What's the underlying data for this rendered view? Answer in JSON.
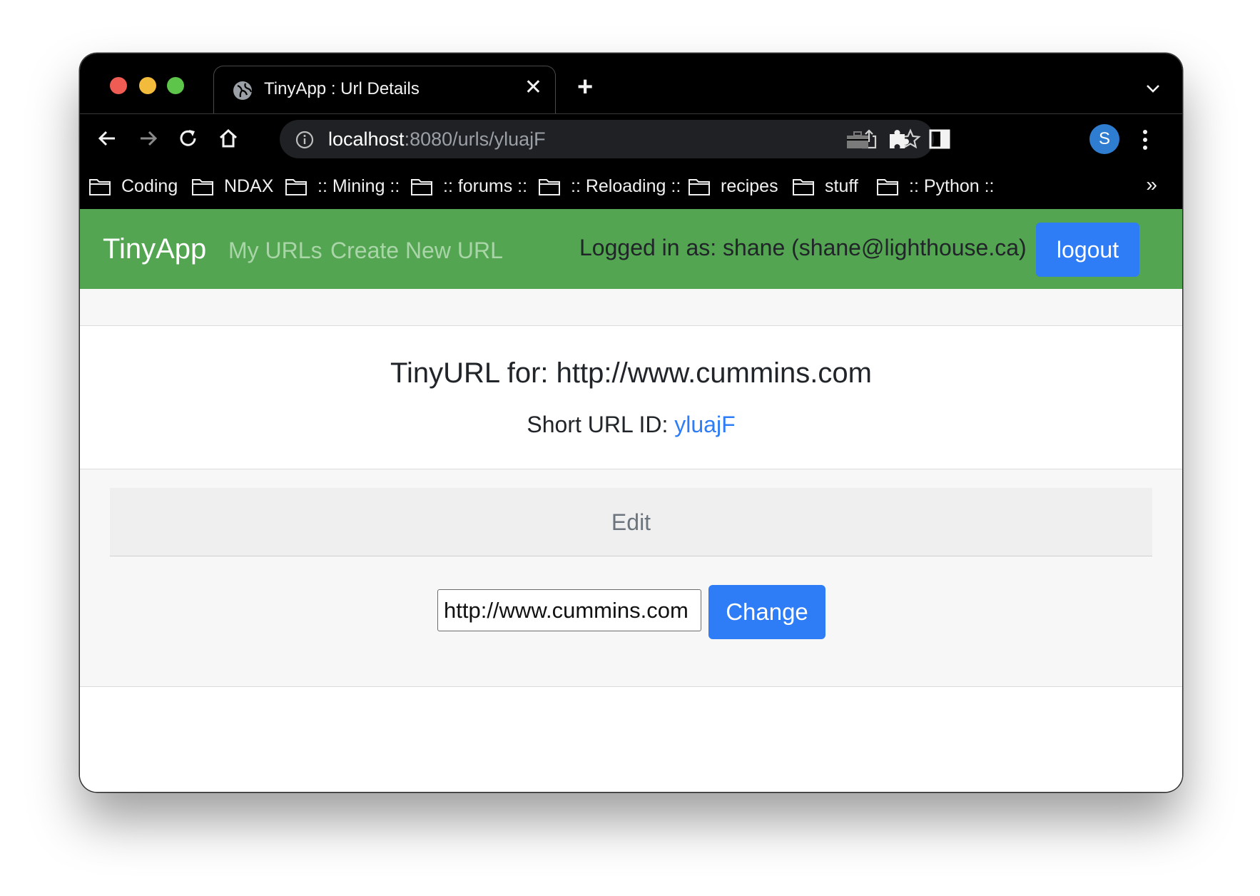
{
  "browser": {
    "tab_title": "TinyApp : Url Details",
    "address": {
      "host": "localhost",
      "rest": ":8080/urls/yluajF"
    },
    "avatar_letter": "S",
    "bookmarks": [
      "Coding",
      "NDAX",
      ":: Mining ::",
      ":: forums ::",
      ":: Reloading ::",
      "recipes",
      "stuff",
      ":: Python ::"
    ],
    "bookmarks_more": "»"
  },
  "navbar": {
    "brand": "TinyApp",
    "links": [
      "My URLs",
      "Create New URL"
    ],
    "logged_in_text": "Logged in as: shane (shane@lighthouse.ca)",
    "logout_label": "logout",
    "color": "#53a551"
  },
  "url_details": {
    "title": "TinyURL for: http://www.cummins.com",
    "short_id_label": "Short URL ID: ",
    "short_id": "yluajF"
  },
  "edit": {
    "heading": "Edit",
    "input_value": "http://www.cummins.com",
    "button_label": "Change"
  },
  "colors": {
    "accent": "#2e7cf6"
  }
}
